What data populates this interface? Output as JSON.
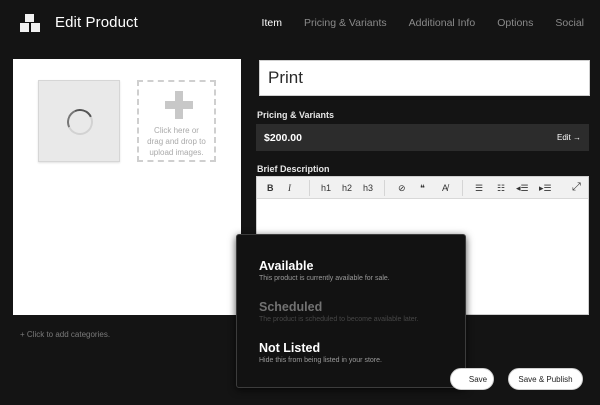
{
  "header": {
    "title": "Edit Product",
    "nav": [
      {
        "label": "Item",
        "active": true
      },
      {
        "label": "Pricing & Variants",
        "active": false
      },
      {
        "label": "Additional Info",
        "active": false
      },
      {
        "label": "Options",
        "active": false
      },
      {
        "label": "Social",
        "active": false
      }
    ]
  },
  "images": {
    "upload_line1": "Click here or",
    "upload_line2": "drag and drop to",
    "upload_line3": "upload images."
  },
  "categories": {
    "link": "+ Click to add categories."
  },
  "product": {
    "name": "Print"
  },
  "pricing": {
    "label": "Pricing & Variants",
    "price": "$200.00",
    "edit": "Edit →"
  },
  "description": {
    "label": "Brief Description",
    "toolbar": {
      "bold": "B",
      "italic": "I",
      "h1": "h1",
      "h2": "h2",
      "h3": "h3",
      "link": "⊘",
      "quote": "❝",
      "clear": "A̸",
      "ul": "☰",
      "ol": "☷",
      "outdent": "◂☰",
      "indent": "▸☰",
      "fullscreen": "⤢"
    }
  },
  "status_menu": {
    "options": [
      {
        "title": "Available",
        "desc": "This product is currently available for sale.",
        "enabled": true
      },
      {
        "title": "Scheduled",
        "desc": "The product is scheduled to become available later.",
        "enabled": false
      },
      {
        "title": "Not Listed",
        "desc": "Hide this from being listed in your store.",
        "enabled": true
      }
    ]
  },
  "actions": {
    "save": "Save",
    "publish": "Save & Publish"
  },
  "colors": {
    "background": "#141414",
    "panel": "#2c2c2c",
    "text": "#ffffff"
  }
}
